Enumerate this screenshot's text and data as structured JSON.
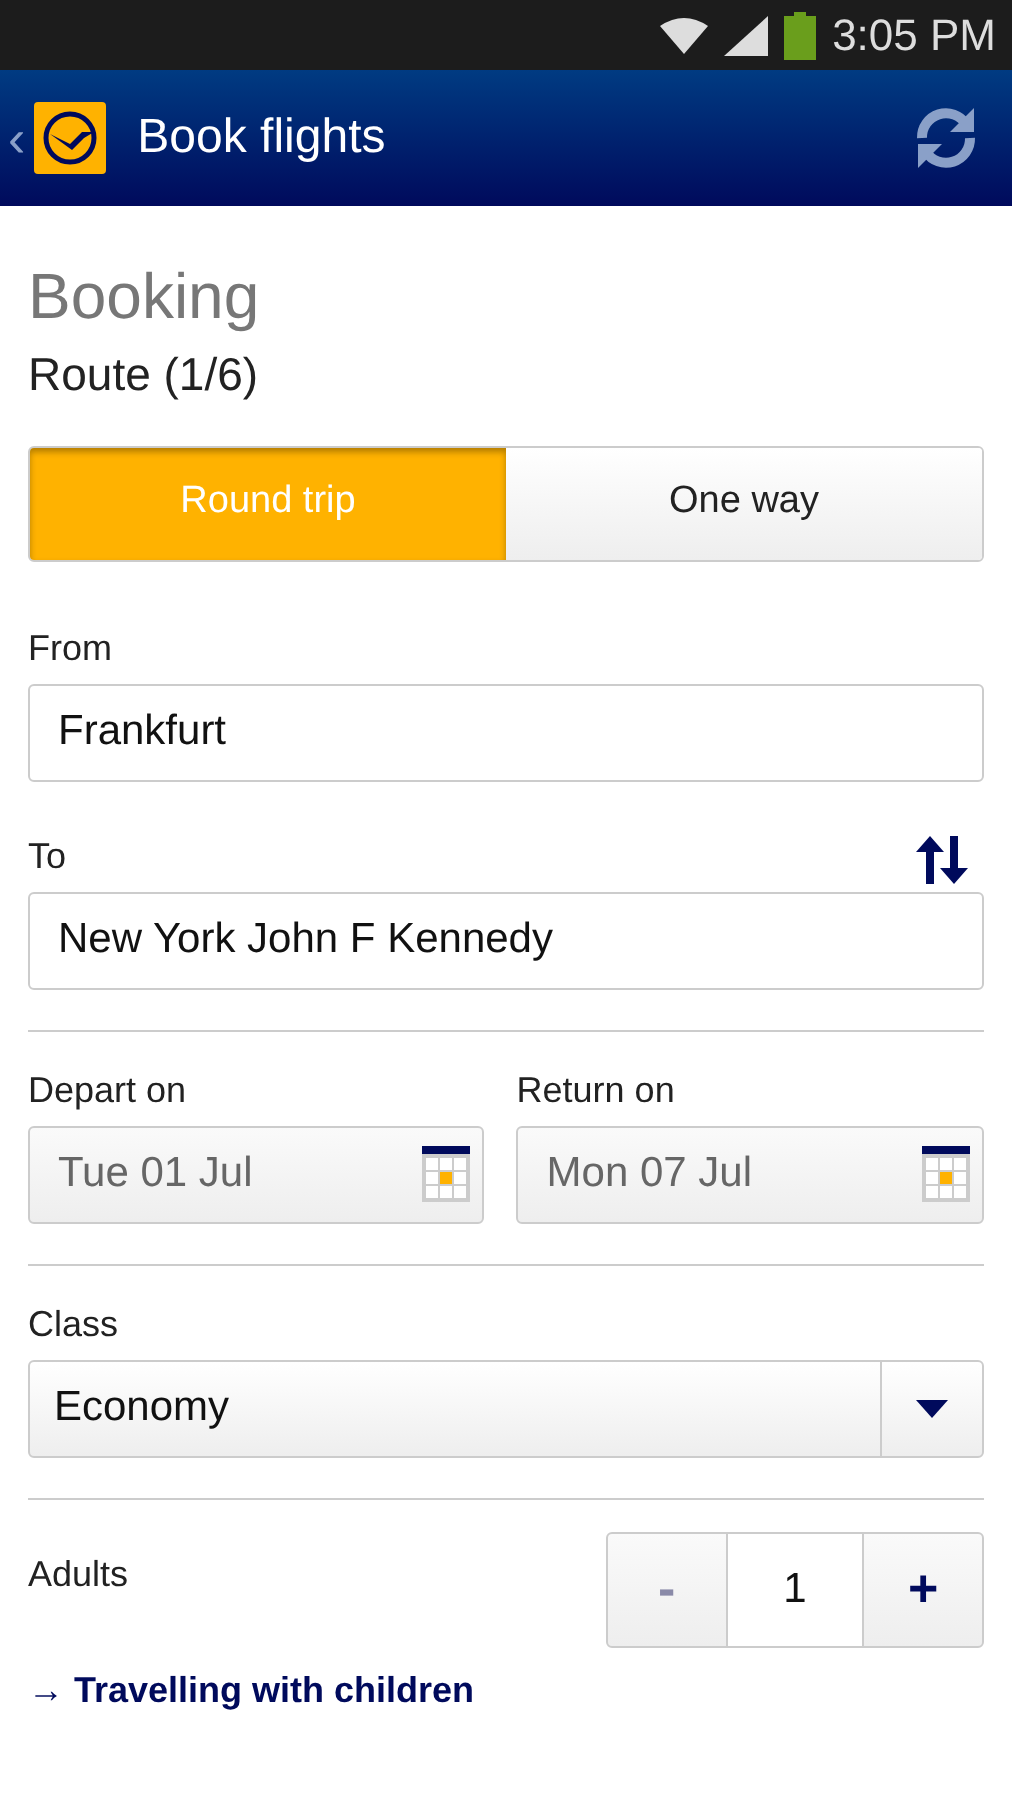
{
  "status_bar": {
    "time": "3:05 PM"
  },
  "app_bar": {
    "back": "‹",
    "title": "Book flights"
  },
  "heading": "Booking",
  "subheading": "Route (1/6)",
  "trip_types": [
    {
      "label": "Round trip",
      "selected": true
    },
    {
      "label": "One way",
      "selected": false
    }
  ],
  "from": {
    "label": "From",
    "value": "Frankfurt"
  },
  "to": {
    "label": "To",
    "value": "New York John F Kennedy"
  },
  "dates": [
    {
      "label": "Depart on",
      "value": "Tue 01 Jul"
    },
    {
      "label": "Return on",
      "value": "Mon 07 Jul"
    }
  ],
  "travel_class": {
    "label": "Class",
    "value": "Economy"
  },
  "adults": {
    "label": "Adults",
    "value": "1",
    "minus": {
      "label": "-",
      "disabled": true
    },
    "plus": {
      "label": "+",
      "disabled": false
    }
  },
  "link": {
    "arrow": "→",
    "label": "Travelling with children"
  }
}
